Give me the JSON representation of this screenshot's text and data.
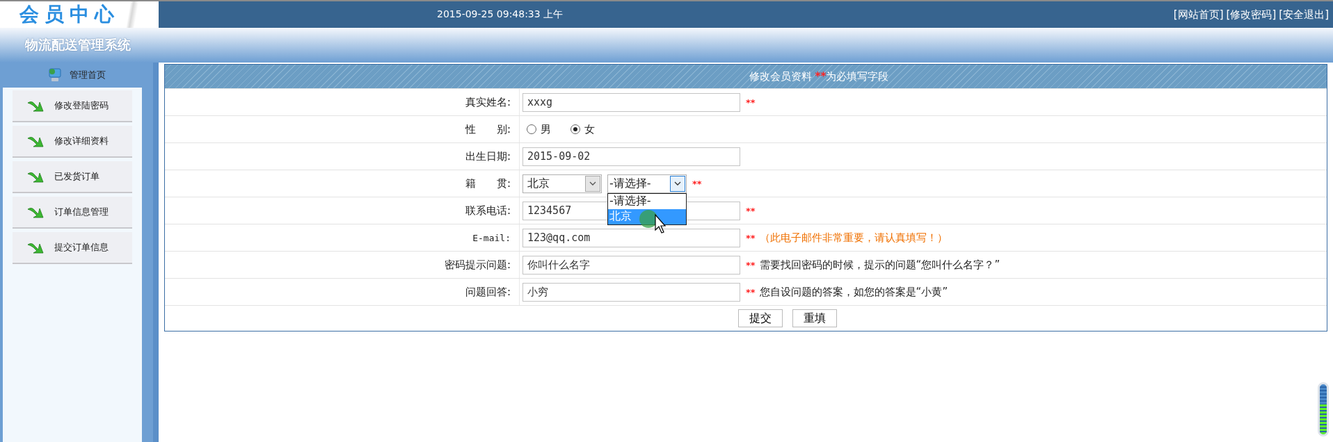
{
  "header": {
    "logo": "会员中心",
    "datetime": "2015-09-25 09:48:33 上午",
    "links": [
      "[网站首页]",
      "[修改密码]",
      "[安全退出]"
    ]
  },
  "banner": {
    "title": "物流配送管理系统"
  },
  "sidebar": {
    "title": "管理首页",
    "items": [
      {
        "label": "修改登陆密码"
      },
      {
        "label": "修改详细资料"
      },
      {
        "label": "已发货订单"
      },
      {
        "label": "订单信息管理"
      },
      {
        "label": "提交订单信息"
      }
    ]
  },
  "form": {
    "title": "修改会员资料",
    "required_mark": "**",
    "title_suffix": "为必填写字段",
    "rows": [
      {
        "kind": "text",
        "label": "真实姓名:",
        "value": "xxxg",
        "required": true
      },
      {
        "kind": "radio",
        "label": "性　　别:",
        "options": [
          {
            "label": "男",
            "selected": false
          },
          {
            "label": "女",
            "selected": true
          }
        ],
        "required": false
      },
      {
        "kind": "text",
        "label": "出生日期:",
        "value": "2015-09-02",
        "required": false
      },
      {
        "kind": "select",
        "label": "籍　　贯:",
        "province": "北京",
        "city": "-请选择-",
        "city_options": [
          {
            "label": "-请选择-",
            "selected": false
          },
          {
            "label": "北京",
            "selected": true
          }
        ],
        "required": true
      },
      {
        "kind": "text",
        "label": "联系电话:",
        "value": "1234567",
        "required": true
      },
      {
        "kind": "text",
        "label": "E-mail:",
        "value": "123@qq.com",
        "required": true,
        "note": {
          "kind": "warning",
          "text": "（此电子邮件非常重要，请认真填写！）"
        }
      },
      {
        "kind": "text",
        "label": "密码提示问题:",
        "value": "你叫什么名字",
        "required": true,
        "note": {
          "kind": "hint",
          "text": "需要找回密码的时候，提示的问题“您叫什么名字？”"
        }
      },
      {
        "kind": "text",
        "label": "问题回答:",
        "value": "小穷",
        "required": true,
        "note": {
          "kind": "hint",
          "text": "您自设问题的答案，如您的答案是“小黄”"
        }
      }
    ],
    "buttons": [
      "提交",
      "重填"
    ]
  },
  "meter": {
    "level": 0.6
  }
}
